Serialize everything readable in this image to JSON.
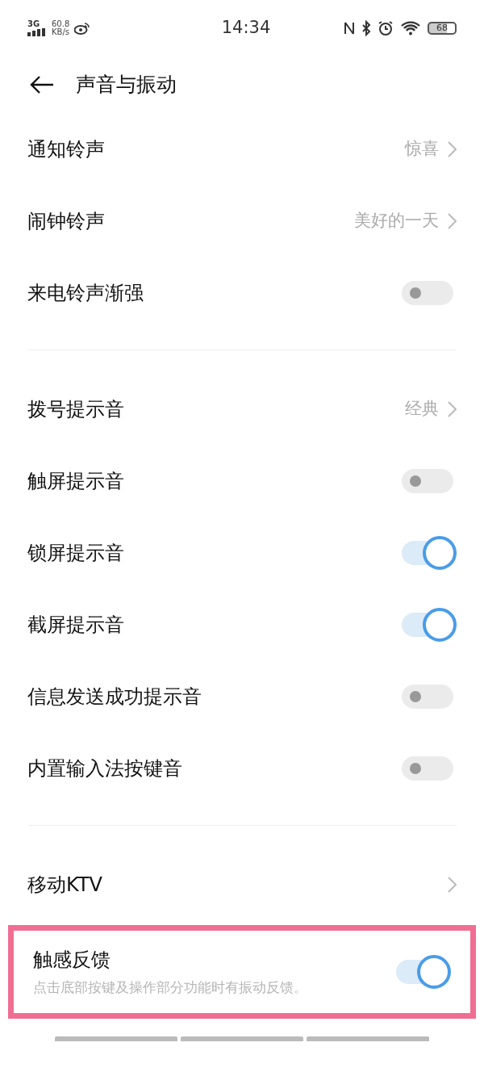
{
  "status_bar": {
    "network": "3G",
    "speed": "60.8",
    "speed_unit": "KB/s",
    "time": "14:34",
    "battery": "68"
  },
  "header": {
    "title": "声音与振动"
  },
  "sections": [
    {
      "items": [
        {
          "kind": "link",
          "label": "通知铃声",
          "value": "惊喜"
        },
        {
          "kind": "link",
          "label": "闹钟铃声",
          "value": "美好的一天"
        },
        {
          "kind": "toggle",
          "label": "来电铃声渐强",
          "on": false
        }
      ]
    },
    {
      "items": [
        {
          "kind": "link",
          "label": "拨号提示音",
          "value": "经典"
        },
        {
          "kind": "toggle",
          "label": "触屏提示音",
          "on": false
        },
        {
          "kind": "toggle",
          "label": "锁屏提示音",
          "on": true
        },
        {
          "kind": "toggle",
          "label": "截屏提示音",
          "on": true
        },
        {
          "kind": "toggle",
          "label": "信息发送成功提示音",
          "on": false
        },
        {
          "kind": "toggle",
          "label": "内置输入法按键音",
          "on": false
        }
      ]
    },
    {
      "items": [
        {
          "kind": "link",
          "label": "移动KTV"
        }
      ]
    },
    {
      "items": [
        {
          "kind": "toggle",
          "label": "触感反馈",
          "on": true,
          "description": "点击底部按键及操作部分功能时有振动反馈。",
          "highlighted": true
        }
      ]
    }
  ]
}
